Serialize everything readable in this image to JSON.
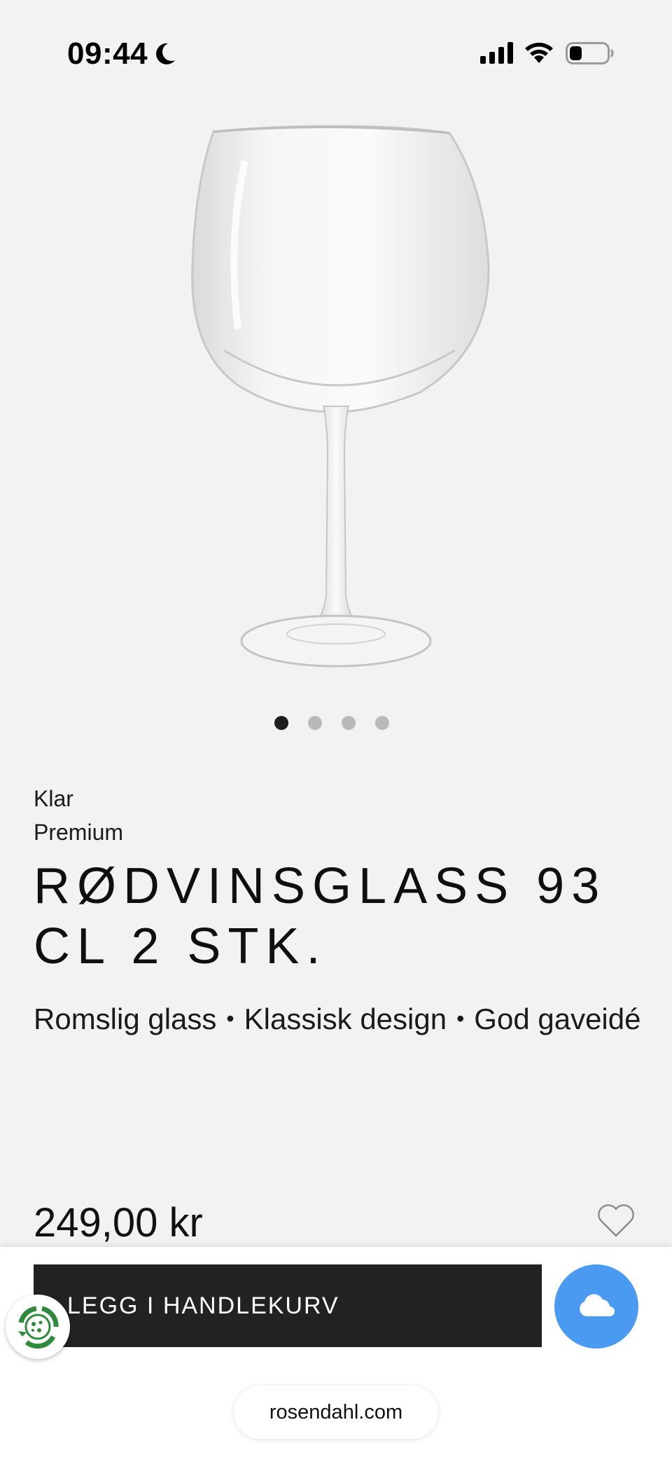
{
  "status_bar": {
    "time": "09:44",
    "icons": [
      "moon-icon",
      "cellular-signal-icon",
      "wifi-icon",
      "battery-icon"
    ]
  },
  "gallery": {
    "image": "wine-glass-image",
    "dots": 4,
    "active_dot": 1
  },
  "product": {
    "color": "Klar",
    "line": "Premium",
    "title": "RØDVINSGLASS 93 CL 2 STK.",
    "features": [
      "Romslig glass",
      "Klassisk design",
      "God gaveidé"
    ],
    "price": "249,00 kr",
    "favorite_icon": "heart-icon"
  },
  "actions": {
    "add_to_cart": "LEGG I HANDLEKURV",
    "cloud_icon": "cloud-icon",
    "eco_icon": "eco-recycle-icon"
  },
  "browser": {
    "url": "rosendahl.com"
  },
  "colors": {
    "background": "#f2f2f2",
    "cart_button": "#222222",
    "cloud_button": "#4a9af2",
    "active_dot": "#1e1e1e",
    "inactive_dot": "#b9b9b9"
  }
}
